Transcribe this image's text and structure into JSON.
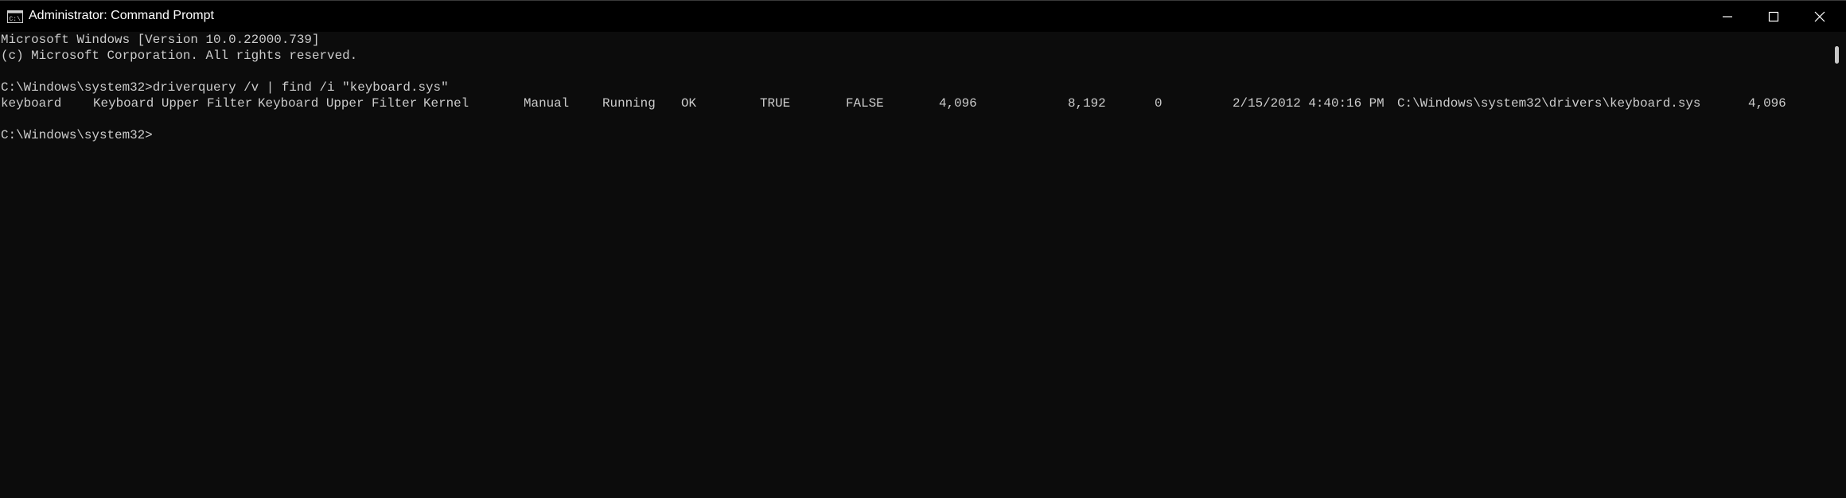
{
  "window": {
    "title": "Administrator: Command Prompt",
    "icon": "cmd-icon",
    "controls": {
      "minimize": "minimize-icon",
      "maximize": "maximize-icon",
      "close": "close-icon"
    }
  },
  "console": {
    "lines": [
      "Microsoft Windows [Version 10.0.22000.739]",
      "(c) Microsoft Corporation. All rights reserved.",
      "C:\\Windows\\system32>driverquery /v | find /i \"keyboard.sys\"",
      "C:\\Windows\\system32>"
    ],
    "result_row": [
      "keyboard",
      "Keyboard Upper Filter",
      "Keyboard Upper Filter",
      "Kernel",
      "Manual",
      "Running",
      "OK",
      "TRUE",
      "FALSE",
      "4,096",
      "8,192",
      "0",
      "2/15/2012 4:40:16 PM",
      "C:\\Windows\\system32\\drivers\\keyboard.sys",
      "4,096"
    ]
  },
  "colors": {
    "background": "#0c0c0c",
    "text": "#cccccc",
    "titlebar": "#000000"
  }
}
